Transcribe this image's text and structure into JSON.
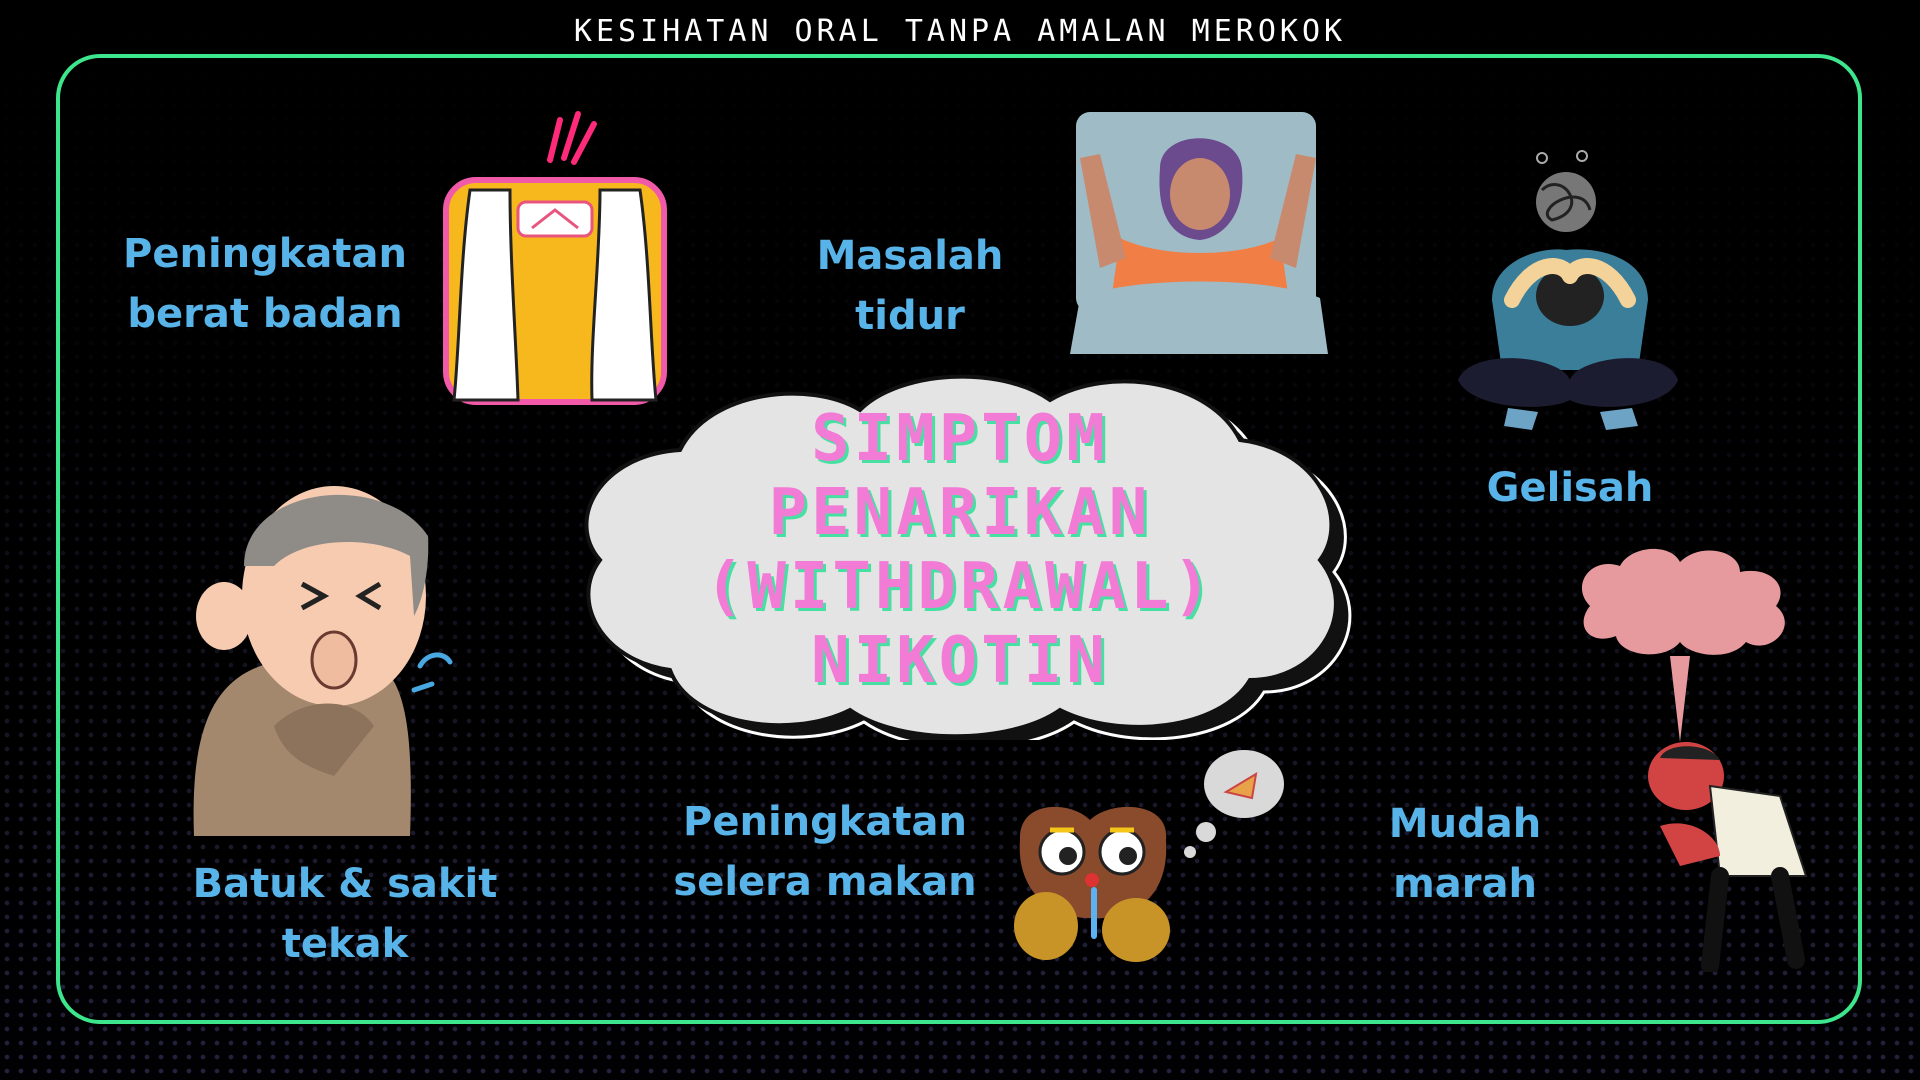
{
  "header": {
    "title": "KESIHATAN ORAL TANPA AMALAN MEROKOK"
  },
  "center": {
    "title_lines": [
      "SIMPTOM",
      "PENARIKAN",
      "(WITHDRAWAL)",
      "NIKOTIN"
    ]
  },
  "symptoms": [
    {
      "line1": "Peningkatan",
      "line2": "berat badan",
      "icon": "weighing-scale-icon"
    },
    {
      "line1": "Masalah",
      "line2": "tidur",
      "icon": "sleepless-person-icon"
    },
    {
      "line1": "Gelisah",
      "line2": "",
      "icon": "anxious-person-icon"
    },
    {
      "line1": "Batuk & sakit",
      "line2": "tekak",
      "icon": "coughing-man-icon"
    },
    {
      "line1": "Peningkatan",
      "line2": "selera makan",
      "icon": "hungry-creature-icon"
    },
    {
      "line1": "Mudah",
      "line2": "marah",
      "icon": "angry-person-icon"
    }
  ],
  "colors": {
    "frame": "#3de58c",
    "label": "#58b4e8",
    "title_pink": "#f27bd6",
    "title_shadow": "#48e0a2"
  }
}
